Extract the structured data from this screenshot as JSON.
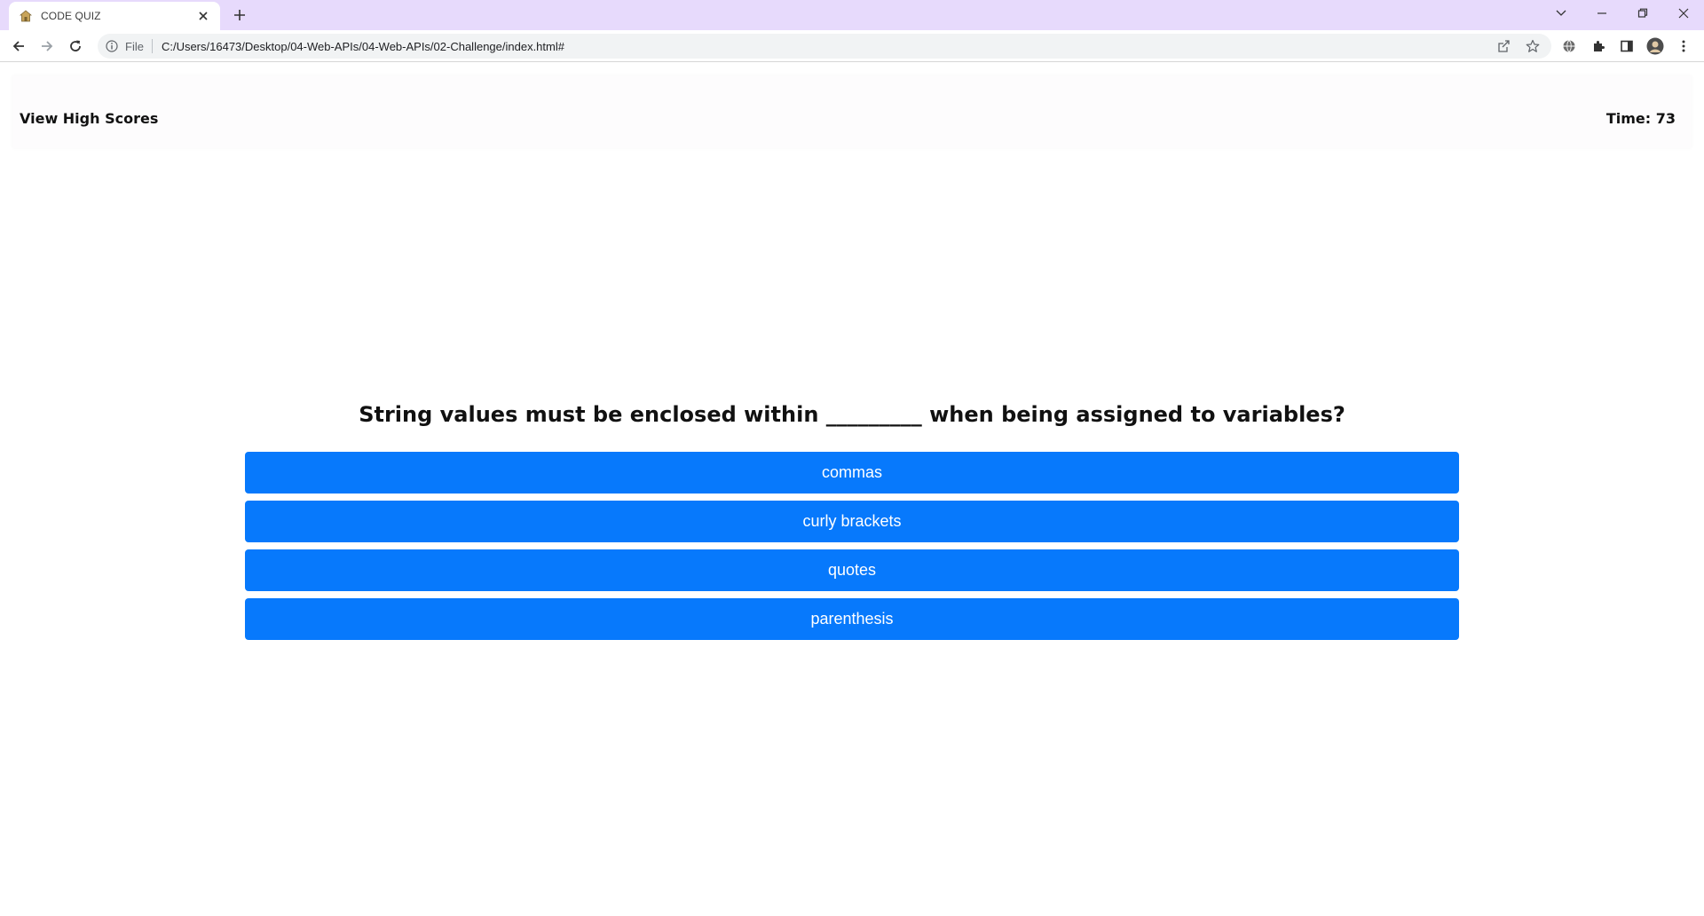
{
  "browser": {
    "tab_title": "CODE QUIZ",
    "omnibox_scheme": "File",
    "url": "C:/Users/16473/Desktop/04-Web-APIs/04-Web-APIs/02-Challenge/index.html#"
  },
  "header": {
    "high_scores_label": "View High Scores",
    "timer_text": "Time: 73"
  },
  "quiz": {
    "question": "String values must be enclosed within _________ when being assigned to variables?",
    "choices": [
      "commas",
      "curly brackets",
      "quotes",
      "parenthesis"
    ]
  },
  "colors": {
    "tabstrip": "#e7dafc",
    "choice_button": "#0779fc"
  }
}
